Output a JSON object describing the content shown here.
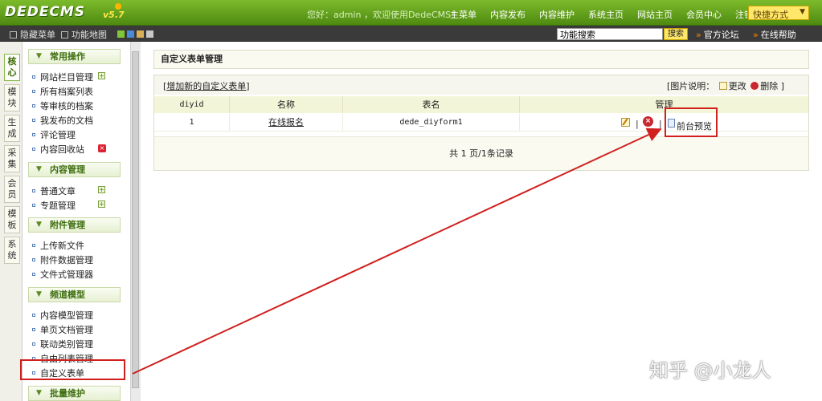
{
  "header": {
    "logo": "DEDECMS",
    "version": "v5.7",
    "welcome": "您好：admin ，欢迎使用DedeCMS！",
    "nav": [
      "主菜单",
      "内容发布",
      "内容维护",
      "系统主页",
      "网站主页",
      "会员中心",
      "注销"
    ],
    "quick_label": "快捷方式"
  },
  "toolbar": {
    "hide_menu": "隐藏菜单",
    "func_map": "功能地图",
    "search_value": "功能搜索",
    "search_button": "搜索",
    "forum_link": "官方论坛",
    "help_link": "在线帮助"
  },
  "vtabs": [
    {
      "label": "核心"
    },
    {
      "label": "模块"
    },
    {
      "label": "生成"
    },
    {
      "label": "采集"
    },
    {
      "label": "会员"
    },
    {
      "label": "模板"
    },
    {
      "label": "系统"
    }
  ],
  "sidebar": {
    "groups": [
      {
        "title": "常用操作",
        "items": [
          "网站栏目管理",
          "所有档案列表",
          "等审核的档案",
          "我发布的文档",
          "评论管理",
          "内容回收站"
        ]
      },
      {
        "title": "内容管理",
        "items": [
          "普通文章",
          "专题管理"
        ]
      },
      {
        "title": "附件管理",
        "items": [
          "上传新文件",
          "附件数据管理",
          "文件式管理器"
        ]
      },
      {
        "title": "频道模型",
        "items": [
          "内容模型管理",
          "单页文档管理",
          "联动类别管理",
          "自由列表管理",
          "自定义表单"
        ]
      },
      {
        "title": "批量维护",
        "items": []
      }
    ]
  },
  "main": {
    "title": "自定义表单管理",
    "add_link": "增加新的自定义表单",
    "legend_label": "[图片说明：",
    "legend_edit": "更改",
    "legend_delete": "删除",
    "legend_close": "]",
    "table": {
      "headers": [
        "diyid",
        "名称",
        "表名",
        "管理"
      ],
      "rows": [
        {
          "diyid": "1",
          "name": "在线报名",
          "table": "dede_diyform1",
          "preview": "前台预览"
        }
      ]
    },
    "pagination": "共 1 页/1条记录"
  },
  "watermark": "知乎 @小龙人",
  "colors": {
    "header_green": "#5e9a1a",
    "highlight_red": "#d0201e",
    "accent_yellow": "#ffe76a"
  }
}
